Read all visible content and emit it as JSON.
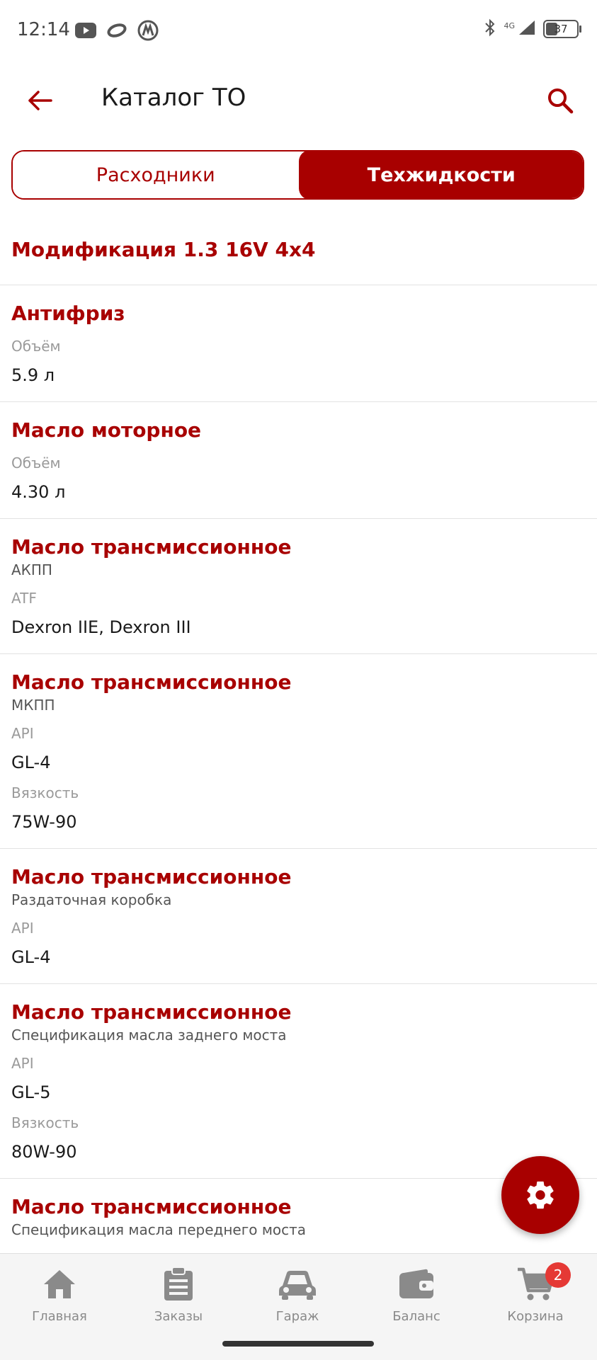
{
  "status": {
    "time": "12:14",
    "network": "4G",
    "battery": "37"
  },
  "header": {
    "title": "Каталог ТО"
  },
  "tabs": [
    {
      "label": "Расходники",
      "active": false
    },
    {
      "label": "Техжидкости",
      "active": true
    }
  ],
  "modification": "Модификация 1.3 16V 4x4",
  "items": [
    {
      "title": "Антифриз",
      "props": [
        {
          "label": "Объём",
          "value": "5.9 л"
        }
      ]
    },
    {
      "title": "Масло моторное",
      "props": [
        {
          "label": "Объём",
          "value": "4.30 л"
        }
      ]
    },
    {
      "title": "Масло трансмиссионное",
      "subtitle": "АКПП",
      "props": [
        {
          "label": "ATF",
          "value": "Dexron IIE, Dexron III"
        }
      ]
    },
    {
      "title": "Масло трансмиссионное",
      "subtitle": "МКПП",
      "props": [
        {
          "label": "API",
          "value": "GL-4"
        },
        {
          "label": "Вязкость",
          "value": "75W-90"
        }
      ]
    },
    {
      "title": "Масло трансмиссионное",
      "subtitle": "Раздаточная коробка",
      "props": [
        {
          "label": "API",
          "value": "GL-4"
        }
      ]
    },
    {
      "title": "Масло трансмиссионное",
      "subtitle": "Спецификация масла заднего моста",
      "props": [
        {
          "label": "API",
          "value": "GL-5"
        },
        {
          "label": "Вязкость",
          "value": "80W-90"
        }
      ]
    },
    {
      "title": "Масло трансмиссионное",
      "subtitle": "Спецификация масла переднего моста",
      "props": []
    }
  ],
  "bottom_nav": [
    {
      "label": "Главная",
      "icon": "home-icon"
    },
    {
      "label": "Заказы",
      "icon": "orders-clipboard-icon"
    },
    {
      "label": "Гараж",
      "icon": "car-icon"
    },
    {
      "label": "Баланс",
      "icon": "wallet-icon"
    },
    {
      "label": "Корзина",
      "icon": "cart-icon",
      "badge": "2"
    }
  ],
  "colors": {
    "accent": "#a80000",
    "badge": "#e53935",
    "nav_icon": "#8a8a8a"
  }
}
